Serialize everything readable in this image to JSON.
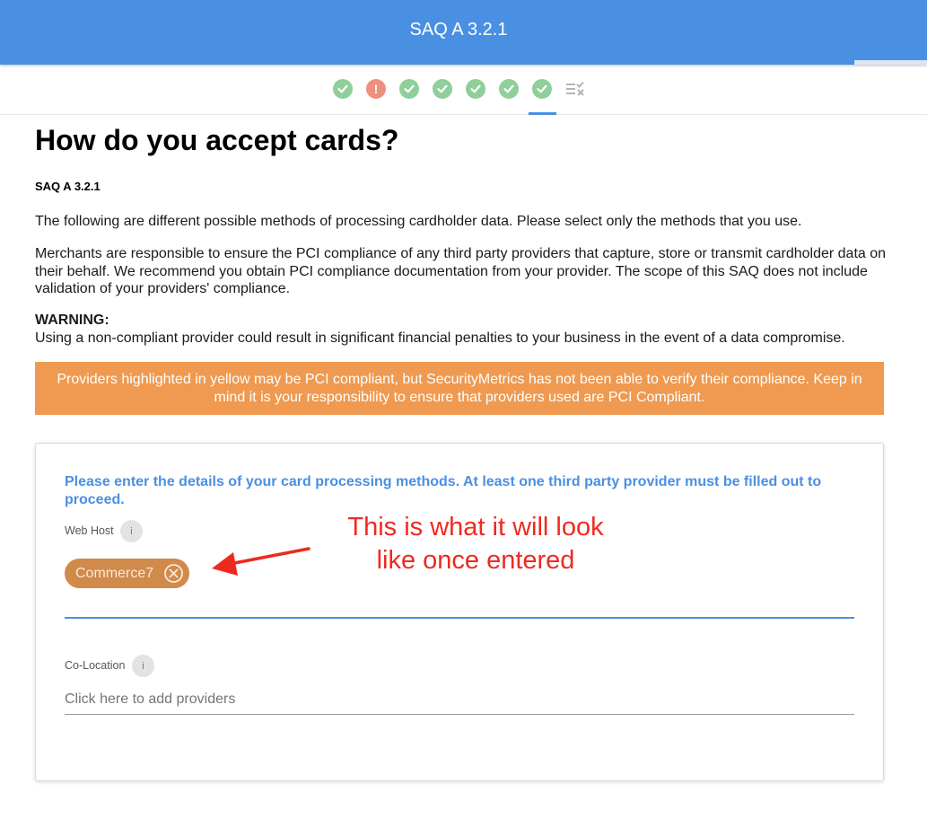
{
  "header": {
    "title": "SAQ A 3.2.1"
  },
  "stepper": {
    "steps": [
      {
        "status": "complete",
        "icon": "check-icon"
      },
      {
        "status": "error",
        "icon": "exclamation-icon",
        "symbol": "!"
      },
      {
        "status": "complete",
        "icon": "check-icon"
      },
      {
        "status": "complete",
        "icon": "check-icon"
      },
      {
        "status": "complete",
        "icon": "check-icon"
      },
      {
        "status": "complete",
        "icon": "check-icon"
      },
      {
        "status": "complete-active",
        "icon": "check-icon"
      },
      {
        "status": "pending",
        "icon": "review-list-icon"
      }
    ],
    "colors": {
      "complete": "#8fcf9a",
      "error": "#ef8f7d",
      "active": "#4a90e2"
    }
  },
  "main": {
    "title": "How do you accept cards?",
    "subtitle": "SAQ A 3.2.1",
    "intro": "The following are different possible methods of processing cardholder data. Please select only the methods that you use.",
    "merchants_note": "Merchants are responsible to ensure the PCI compliance of any third party providers that capture, store or transmit cardholder data on their behalf. We recommend you obtain PCI compliance documentation from your provider. The scope of this SAQ does not include validation of your providers' compliance.",
    "warning_label": "WARNING:",
    "warning_text": "Using a non-compliant provider could result in significant financial penalties to your business in the event of a data compromise."
  },
  "alert": {
    "text": "Providers highlighted in yellow may be PCI compliant, but SecurityMetrics has not been able to verify their compliance. Keep in mind it is your responsibility to ensure that providers used are PCI Compliant.",
    "color": "#ef9a50"
  },
  "form": {
    "intro": "Please enter the details of your card processing methods. At least one third party provider must be filled out to proceed.",
    "web_host": {
      "label": "Web Host",
      "info": "i",
      "chips": [
        {
          "label": "Commerce7",
          "color": "#d08a4a"
        }
      ]
    },
    "co_location": {
      "label": "Co-Location",
      "info": "i",
      "placeholder": "Click here to add providers"
    }
  },
  "annotation": {
    "line1": "This is what it will look",
    "line2": "like once entered",
    "color": "#ee2a1f"
  }
}
